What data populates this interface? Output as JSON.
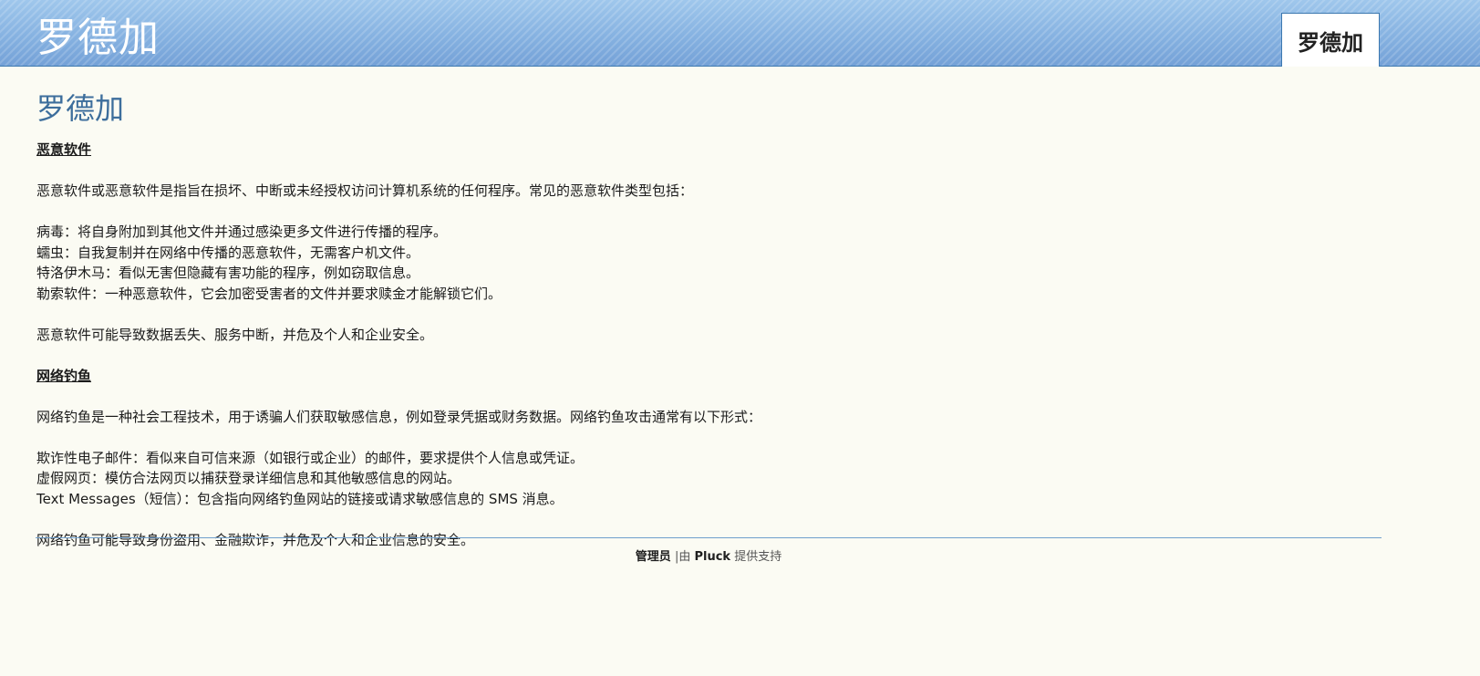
{
  "header": {
    "site_title": "罗德加",
    "nav_tab_label": "罗德加"
  },
  "page": {
    "title": "罗德加"
  },
  "sections": {
    "malware": {
      "heading": "恶意软件",
      "intro": "恶意软件或恶意软件是指旨在损坏、中断或未经授权访问计算机系统的任何程序。常见的恶意软件类型包括：",
      "items": [
        "病毒：将自身附加到其他文件并通过感染更多文件进行传播的程序。",
        "蠕虫：自我复制并在网络中传播的恶意软件，无需客户机文件。",
        "特洛伊木马：看似无害但隐藏有害功能的程序，例如窃取信息。",
        "勒索软件：一种恶意软件，它会加密受害者的文件并要求赎金才能解锁它们。"
      ],
      "outro": "恶意软件可能导致数据丢失、服务中断，并危及个人和企业安全。"
    },
    "phishing": {
      "heading": "网络钓鱼",
      "intro": "网络钓鱼是一种社会工程技术，用于诱骗人们获取敏感信息，例如登录凭据或财务数据。网络钓鱼攻击通常有以下形式：",
      "items": [
        "欺诈性电子邮件：看似来自可信来源（如银行或企业）的邮件，要求提供个人信息或凭证。",
        "虚假网页：模仿合法网页以捕获登录详细信息和其他敏感信息的网站。",
        "Text Messages（短信）：包含指向网络钓鱼网站的链接或请求敏感信息的 SMS 消息。"
      ],
      "outro": "网络钓鱼可能导致身份盗用、金融欺诈，并危及个人和企业信息的安全。"
    }
  },
  "footer": {
    "admin_link": "管理员",
    "separator_text": " |由 ",
    "pluck_link": "Pluck",
    "powered_text": " 提供支持"
  }
}
